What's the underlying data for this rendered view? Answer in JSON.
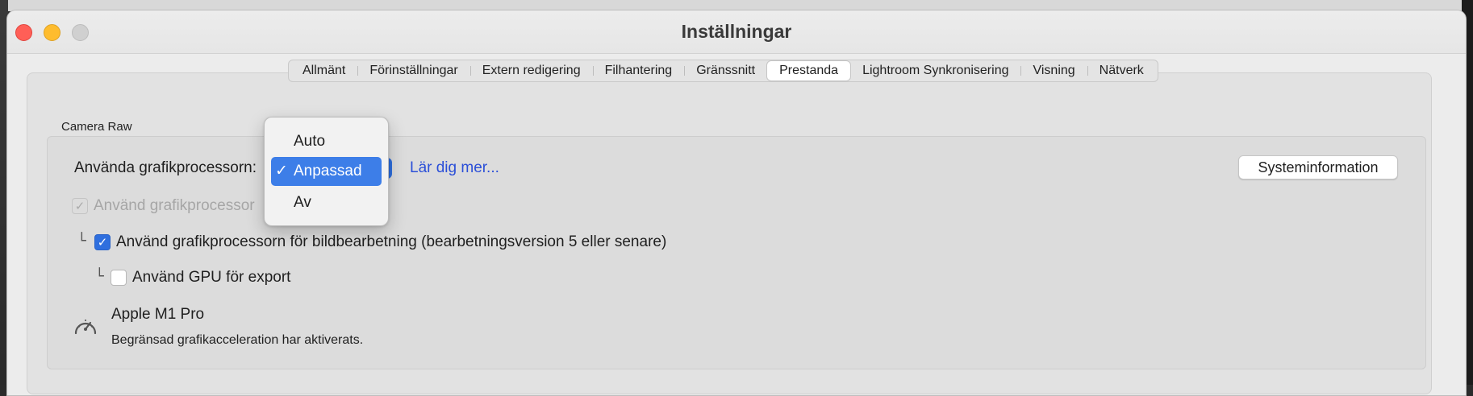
{
  "window": {
    "title": "Inställningar"
  },
  "tabs": [
    {
      "label": "Allmänt",
      "active": false
    },
    {
      "label": "Förinställningar",
      "active": false
    },
    {
      "label": "Extern redigering",
      "active": false
    },
    {
      "label": "Filhantering",
      "active": false
    },
    {
      "label": "Gränssnitt",
      "active": false
    },
    {
      "label": "Prestanda",
      "active": true
    },
    {
      "label": "Lightroom Synkronisering",
      "active": false
    },
    {
      "label": "Visning",
      "active": false
    },
    {
      "label": "Nätverk",
      "active": false
    }
  ],
  "camera_raw": {
    "group_label": "Camera Raw",
    "gpu_label": "Använda grafikprocessorn:",
    "gpu_options": [
      "Auto",
      "Anpassad",
      "Av"
    ],
    "gpu_selected": "Anpassad",
    "learn_more": "Lär dig mer...",
    "system_info_button": "Systeminformation",
    "disabled_checkbox_label": "Använd grafikprocessor",
    "image_processing_label": "Använd grafikprocessorn för bildbearbetning (bearbetningsversion 5 eller senare)",
    "export_label": "Använd GPU för export",
    "tree_glyph": "└",
    "check_glyph": "✓",
    "device_name": "Apple M1 Pro",
    "device_status": "Begränsad grafikacceleration har aktiverats."
  },
  "icons": {
    "gauge": "gauge-icon"
  },
  "colors": {
    "accent": "#3d7ee8",
    "link": "#2b4fd8",
    "close": "#ff5f57",
    "minimize": "#febc2e"
  }
}
